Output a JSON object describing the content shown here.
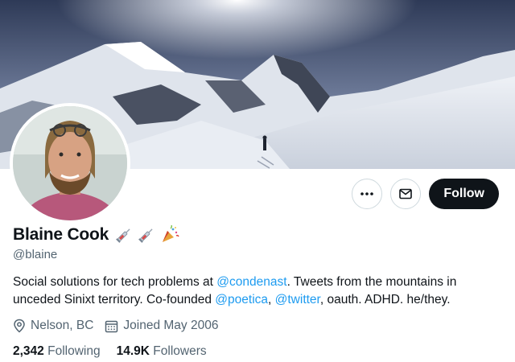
{
  "profile": {
    "display_name": "Blaine Cook",
    "name_emojis": [
      "syringe-emoji",
      "syringe-emoji",
      "party-popper-emoji"
    ],
    "handle": "@blaine",
    "bio": {
      "p1": "Social solutions for tech problems at ",
      "link1": "@condenast",
      "p2": ". Tweets from the mountains in unceded Sinixt territory. Co-founded ",
      "link2": "@poetica",
      "p3": ", ",
      "link3": "@twitter",
      "p4": ", oauth. ADHD. he/they."
    },
    "location": "Nelson, BC",
    "joined": "Joined May 2006",
    "following_count": "2,342",
    "following_label": "Following",
    "followers_count": "14.9K",
    "followers_label": "Followers"
  },
  "actions": {
    "more_icon": "more-horizontal-icon",
    "message_icon": "envelope-icon",
    "follow_label": "Follow"
  },
  "colors": {
    "accent": "#1d9bf0",
    "text": "#0f1419",
    "secondary": "#536471",
    "follow_bg": "#0f1419"
  }
}
